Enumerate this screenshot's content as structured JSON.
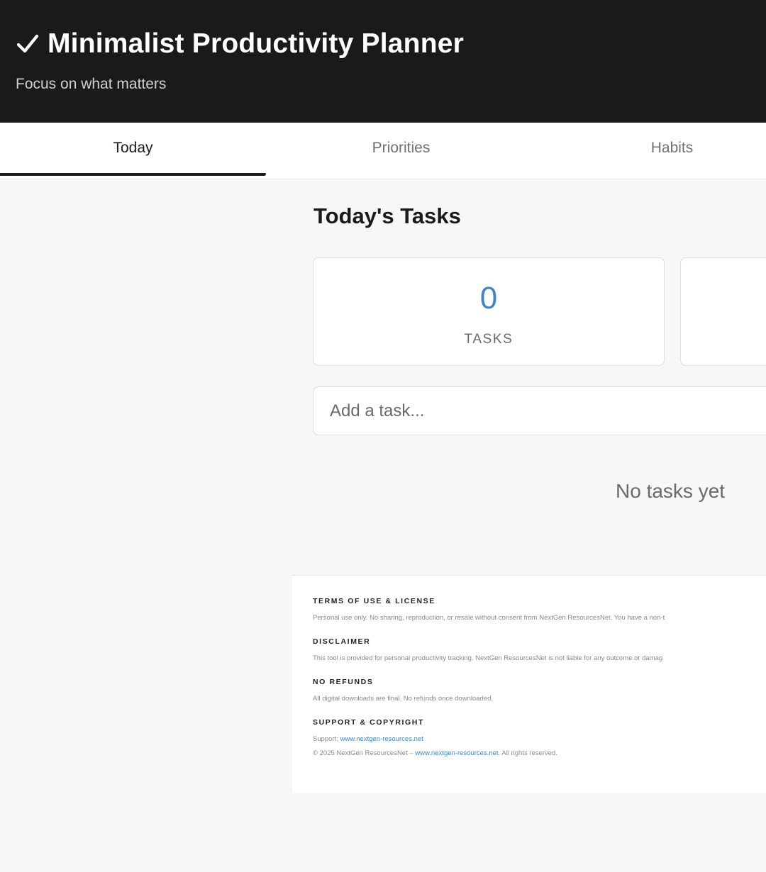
{
  "header": {
    "title": "Minimalist Productivity Planner",
    "subtitle": "Focus on what matters"
  },
  "tabs": [
    {
      "label": "Today",
      "active": true
    },
    {
      "label": "Priorities",
      "active": false
    },
    {
      "label": "Habits",
      "active": false
    }
  ],
  "main": {
    "section_title": "Today's Tasks",
    "stats": [
      {
        "value": "0",
        "label": "TASKS"
      }
    ],
    "task_input": {
      "value": "",
      "placeholder": "Add a task..."
    },
    "empty_state": "No tasks yet"
  },
  "footer": {
    "terms": {
      "heading": "Terms of Use & License",
      "text": "Personal use only. No sharing, reproduction, or resale without consent from NextGen ResourcesNet. You have a non-t"
    },
    "disclaimer": {
      "heading": "Disclaimer",
      "text": "This tool is provided for personal productivity tracking. NextGen ResourcesNet is not liable for any outcome or damag"
    },
    "refunds": {
      "heading": "No Refunds",
      "text": "All digital downloads are final. No refunds once downloaded."
    },
    "support": {
      "heading": "Support & Copyright",
      "support_prefix": "Support: ",
      "support_link": "www.nextgen-resources.net",
      "copyright_prefix": "© 2025 NextGen ResourcesNet – ",
      "copyright_link": "www.nextgen-resources.net",
      "copyright_suffix": ". All rights reserved."
    }
  },
  "colors": {
    "header_bg": "#1a1a1a",
    "accent": "#3d85c6",
    "page_bg": "#f7f7f7"
  },
  "icons": {
    "title_icon": "check-icon"
  }
}
